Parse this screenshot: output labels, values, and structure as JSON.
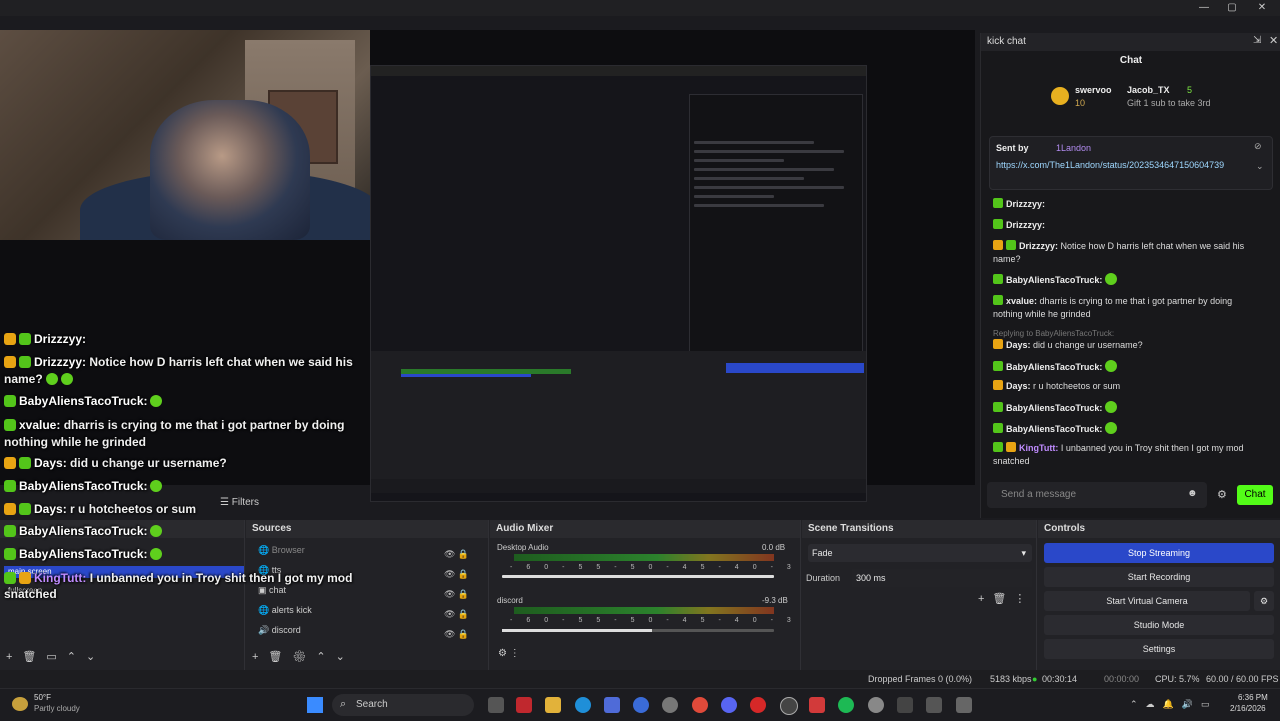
{
  "window": {
    "minimize": "—",
    "maximize": "▢",
    "close": "✕"
  },
  "overlay_chat": [
    {
      "name": "Drizzzyy:",
      "msg": ""
    },
    {
      "name": "Drizzzyy:",
      "msg": "Notice how D harris left chat when we said his name?"
    },
    {
      "name": "BabyAliensTacoTruck:",
      "msg": ""
    },
    {
      "name": "xvalue:",
      "msg": "dharris is crying to me that i got partner by doing nothing while he grinded"
    },
    {
      "name": "Days:",
      "msg": "did u change ur username?"
    },
    {
      "name": "BabyAliensTacoTruck:",
      "msg": ""
    },
    {
      "name": "Days:",
      "msg": "r u hotcheetos or sum"
    },
    {
      "name": "BabyAliensTacoTruck:",
      "msg": ""
    },
    {
      "name": "BabyAliensTacoTruck:",
      "msg": ""
    },
    {
      "name": "KingTutt:",
      "msg": "I unbanned you in Troy shit then I got my mod snatched"
    }
  ],
  "kick": {
    "window_title": "kick chat",
    "tab_title": "Chat",
    "pinned": {
      "user": "swervoo",
      "amount": "10",
      "user2": "Jacob_TX",
      "count": "5",
      "gift": "Gift 1 sub to take 3rd"
    },
    "sent_by_label": "Sent by",
    "sent_by_user": "1Landon",
    "link": "https://x.com/The1Landon/status/2023534647150604739",
    "messages": [
      {
        "name": "Drizzzyy:",
        "msg": ""
      },
      {
        "name": "Drizzzyy:",
        "msg": ""
      },
      {
        "name": "Drizzzyy:",
        "msg": "Notice how D harris left chat when we said his name?"
      },
      {
        "name": "BabyAliensTacoTruck:",
        "msg": ""
      },
      {
        "name": "xvalue:",
        "msg": "dharris is crying to me that i got partner by doing nothing while he grinded"
      },
      {
        "name": "Replying to BabyAliensTacoTruck:",
        "msg": ""
      },
      {
        "name": "Days:",
        "msg": "did u change ur username?"
      },
      {
        "name": "BabyAliensTacoTruck:",
        "msg": ""
      },
      {
        "name": "Days:",
        "msg": "r u hotcheetos or sum"
      },
      {
        "name": "BabyAliensTacoTruck:",
        "msg": ""
      },
      {
        "name": "BabyAliensTacoTruck:",
        "msg": ""
      },
      {
        "name": "KingTutt:",
        "msg": "I unbanned you in Troy shit then I got my mod snatched"
      }
    ],
    "input_placeholder": "Send a message",
    "chat_button": "Chat"
  },
  "filters_label": "Filters",
  "scenes": {
    "title": "",
    "items": [
      "main screen",
      "fullscreen"
    ]
  },
  "sources": {
    "title": "Sources",
    "items": [
      "Browser",
      "tts",
      "chat",
      "alerts kick",
      "discord"
    ]
  },
  "mixer": {
    "title": "Audio Mixer",
    "channels": [
      {
        "name": "Desktop Audio",
        "db": "0.0 dB",
        "level": 0.71
      },
      {
        "name": "discord",
        "db": "-9.3 dB",
        "level": 0.55
      }
    ],
    "ticks": [
      "-60",
      "-55",
      "-50",
      "-45",
      "-40",
      "-35",
      "-30",
      "-25",
      "-20",
      "-15",
      "-10",
      "-5",
      "0"
    ]
  },
  "transitions": {
    "title": "Scene Transitions",
    "selected": "Fade",
    "duration_label": "Duration",
    "duration_value": "300 ms"
  },
  "controls": {
    "title": "Controls",
    "buttons": [
      "Stop Streaming",
      "Start Recording",
      "Start Virtual Camera",
      "Studio Mode",
      "Settings"
    ]
  },
  "status": {
    "dropped": "Dropped Frames 0 (0.0%)",
    "kbps": "5183 kbps",
    "live": "00:30:14",
    "rec": "00:00:00",
    "cpu": "CPU: 5.7%",
    "fps": "60.00 / 60.00 FPS"
  },
  "taskbar": {
    "temp": "50°F",
    "weather": "Partly cloudy",
    "search": "Search",
    "time": "6:36 PM",
    "date": "2/16/2026"
  },
  "colors": {
    "accent_blue": "#2a48c9",
    "kick_green": "#53fc18",
    "live_green": "#3c3"
  }
}
